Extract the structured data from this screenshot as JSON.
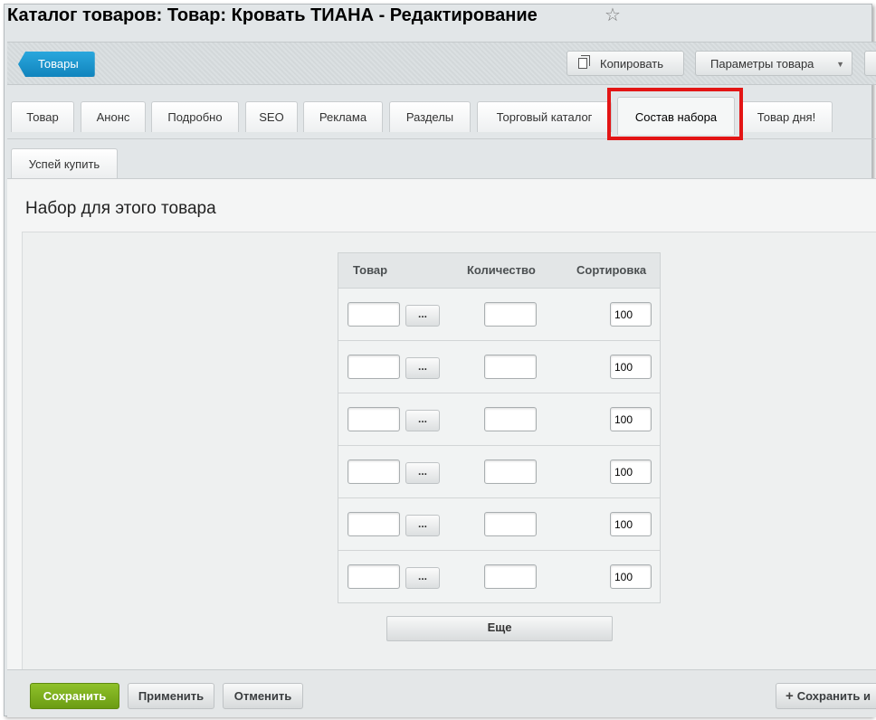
{
  "header": {
    "title": "Каталог товаров: Товар: Кровать ТИАНА - Редактирование",
    "favorite_icon": "star-icon"
  },
  "toolbar": {
    "back_label": "Товары",
    "copy_label": "Копировать",
    "params_label": "Параметры товара"
  },
  "tabs": [
    {
      "label": "Товар"
    },
    {
      "label": "Анонс"
    },
    {
      "label": "Подробно"
    },
    {
      "label": "SEO"
    },
    {
      "label": "Реклама"
    },
    {
      "label": "Разделы"
    },
    {
      "label": "Торговый каталог"
    },
    {
      "label": "Состав набора",
      "active": true
    },
    {
      "label": "Товар дня!"
    }
  ],
  "subtabs": [
    {
      "label": "Успей купить"
    }
  ],
  "set_section": {
    "title": "Набор для этого товара",
    "columns": [
      "Товар",
      "Количество",
      "Сортировка"
    ],
    "rows": [
      {
        "product": "",
        "quantity": "",
        "sort": "100"
      },
      {
        "product": "",
        "quantity": "",
        "sort": "100"
      },
      {
        "product": "",
        "quantity": "",
        "sort": "100"
      },
      {
        "product": "",
        "quantity": "",
        "sort": "100"
      },
      {
        "product": "",
        "quantity": "",
        "sort": "100"
      },
      {
        "product": "",
        "quantity": "",
        "sort": "100"
      }
    ],
    "browse_label": "...",
    "more_label": "Еще"
  },
  "footer": {
    "save_label": "Сохранить",
    "apply_label": "Применить",
    "cancel_label": "Отменить",
    "save_add_label": "Сохранить и"
  },
  "colors": {
    "accent_blue": "#1a94cf",
    "save_green": "#7aad1c",
    "highlight_red": "#e31515"
  }
}
